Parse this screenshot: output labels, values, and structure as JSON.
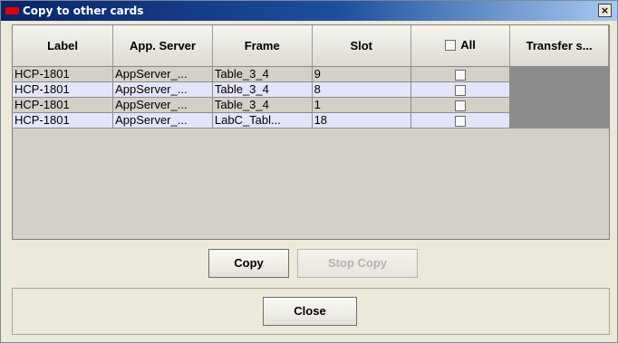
{
  "window": {
    "title": "Copy to other cards",
    "close_glyph": "×"
  },
  "table": {
    "columns": {
      "label": "Label",
      "app_server": "App. Server",
      "frame": "Frame",
      "slot": "Slot",
      "all": "All",
      "transfer": "Transfer s..."
    },
    "rows": [
      {
        "label": "HCP-1801",
        "app_server": "AppServer_...",
        "frame": "Table_3_4",
        "slot": "9"
      },
      {
        "label": "HCP-1801",
        "app_server": "AppServer_...",
        "frame": "Table_3_4",
        "slot": "8"
      },
      {
        "label": "HCP-1801",
        "app_server": "AppServer_...",
        "frame": "Table_3_4",
        "slot": "1"
      },
      {
        "label": "HCP-1801",
        "app_server": "AppServer_...",
        "frame": "LabC_Tabl...",
        "slot": "18"
      }
    ]
  },
  "buttons": {
    "copy": "Copy",
    "stop_copy": "Stop Copy",
    "close": "Close"
  },
  "colors": {
    "title_gradient_start": "#0a246a",
    "title_gradient_end": "#a6caf0",
    "title_icon": "#e00000",
    "row_alt": "#e4e4fc",
    "row_base": "#d4d0c8",
    "transfer_cell": "#8c8c8c"
  }
}
